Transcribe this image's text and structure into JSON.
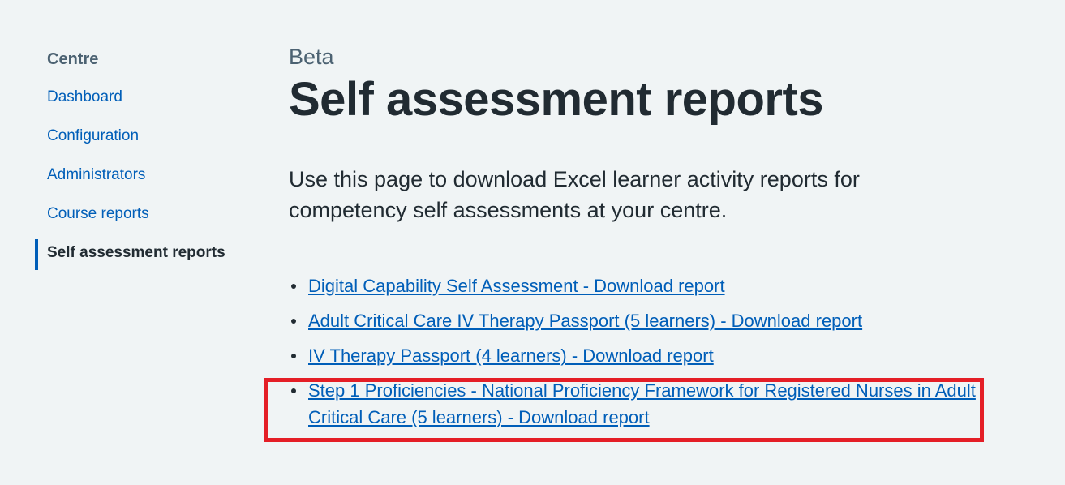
{
  "sidebar": {
    "heading": "Centre",
    "items": [
      {
        "label": "Dashboard"
      },
      {
        "label": "Configuration"
      },
      {
        "label": "Administrators"
      },
      {
        "label": "Course reports"
      },
      {
        "label": "Self assessment reports"
      }
    ]
  },
  "main": {
    "caption": "Beta",
    "title": "Self assessment reports",
    "lede": "Use this page to download Excel learner activity reports for competency self assessments at your centre.",
    "reports": [
      {
        "label": "Digital Capability Self Assessment - Download report"
      },
      {
        "label": "Adult Critical Care IV Therapy Passport (5 learners) - Download report"
      },
      {
        "label": "IV Therapy Passport (4 learners) - Download report"
      },
      {
        "label": "Step 1 Proficiencies - National Proficiency Framework for Registered Nurses in Adult Critical Care (5 learners) - Download report"
      }
    ]
  },
  "colors": {
    "background": "#f0f4f5",
    "link": "#005eb8",
    "text": "#212b32",
    "secondary_text": "#4c6272",
    "highlight": "#e41e26"
  }
}
